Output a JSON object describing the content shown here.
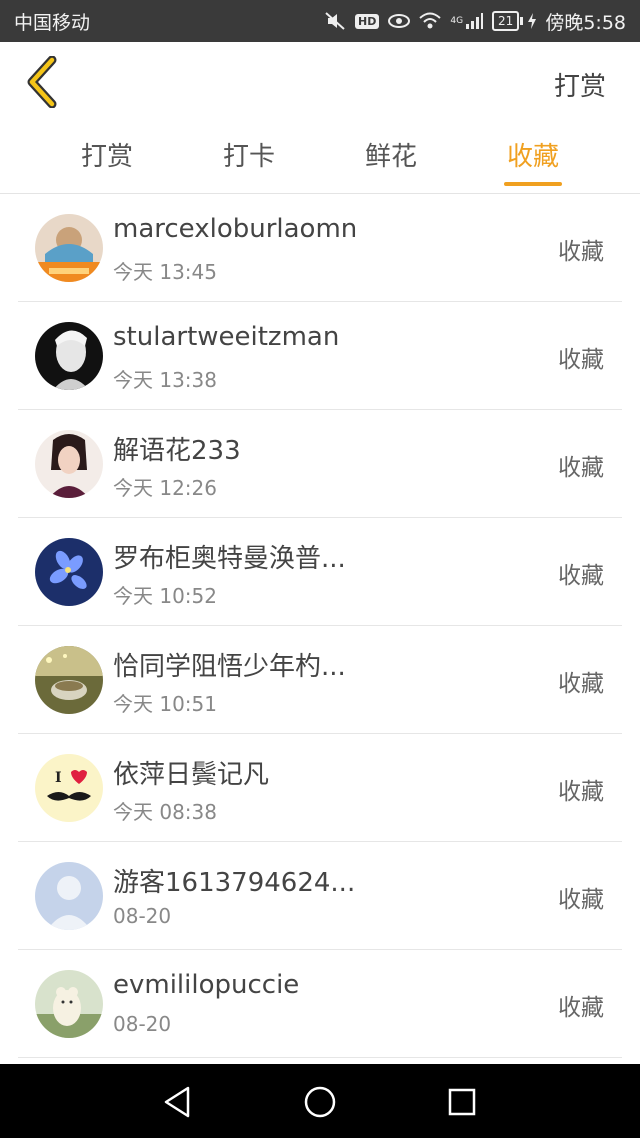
{
  "status_bar": {
    "carrier": "中国移动",
    "network": "4G",
    "hd": "HD",
    "battery": "21",
    "time": "傍晚5:58"
  },
  "header": {
    "back_icon": "chevron-left-icon",
    "action_label": "打赏"
  },
  "tabs": [
    {
      "label": "打赏",
      "active": false
    },
    {
      "label": "打卡",
      "active": false
    },
    {
      "label": "鲜花",
      "active": false
    },
    {
      "label": "收藏",
      "active": true
    }
  ],
  "accent_color": "#f0a020",
  "list": [
    {
      "name": "marcexloburlaomn",
      "time": "今天 13:45",
      "action": "收藏"
    },
    {
      "name": "stulartweeitzman",
      "time": "今天 13:38",
      "action": "收藏"
    },
    {
      "name": "解语花233",
      "time": "今天 12:26",
      "action": "收藏"
    },
    {
      "name": "罗布柜奥特曼涣普...",
      "time": "今天 10:52",
      "action": "收藏"
    },
    {
      "name": "恰同学阻悟少年杓...",
      "time": "今天 10:51",
      "action": "收藏"
    },
    {
      "name": "依萍日鬓记凡",
      "time": "今天 08:38",
      "action": "收藏"
    },
    {
      "name": "游客1613794624...",
      "time": "08-20",
      "action": "收藏"
    },
    {
      "name": "evmililopuccie",
      "time": "08-20",
      "action": "收藏"
    }
  ],
  "nav_bar": {
    "back": "triangle-back-icon",
    "home": "circle-home-icon",
    "recents": "square-recents-icon"
  }
}
